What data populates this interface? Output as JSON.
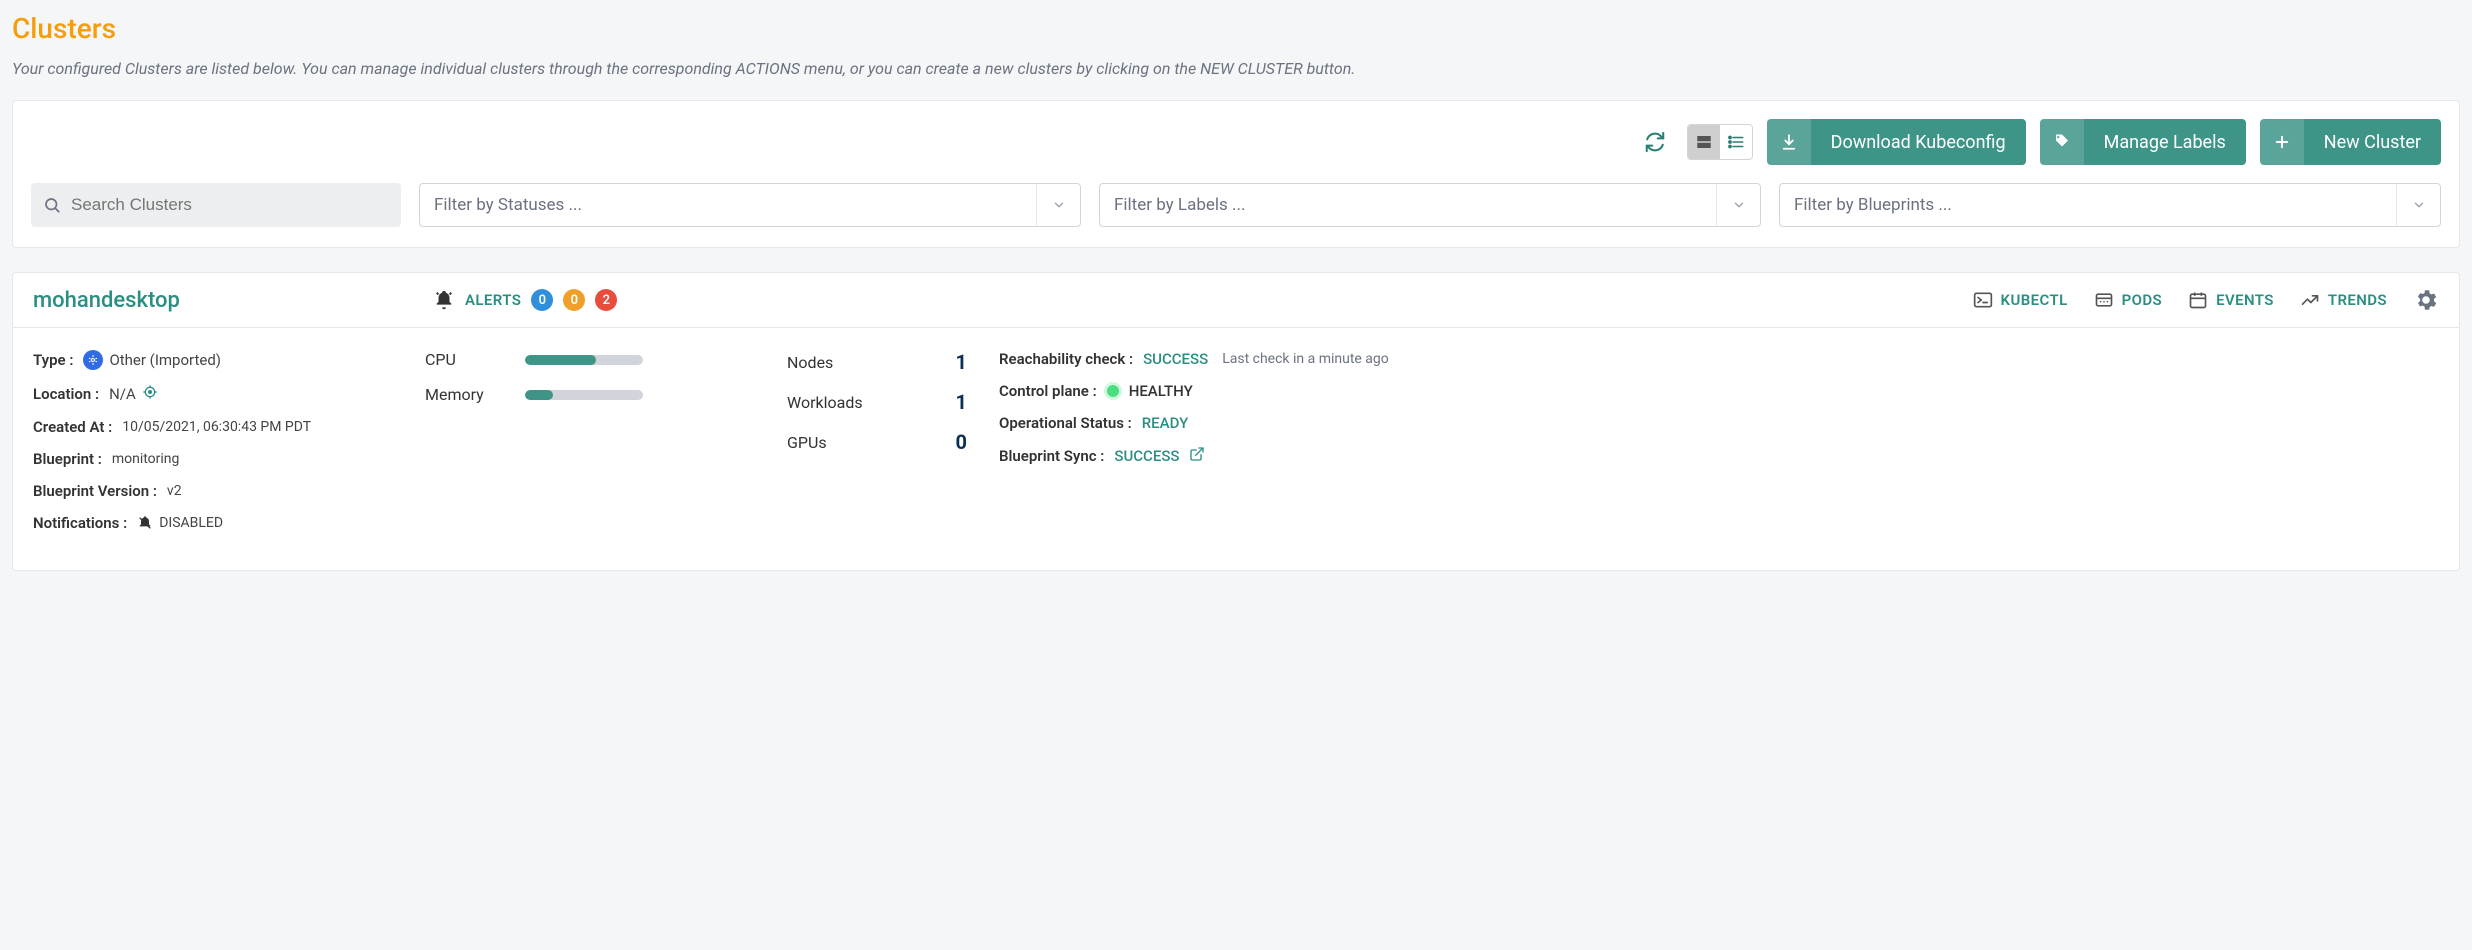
{
  "page": {
    "title": "Clusters",
    "subtitle": "Your configured Clusters are listed below. You can manage individual clusters through the corresponding ACTIONS menu, or you can create a new clusters by clicking on the NEW CLUSTER button."
  },
  "toolbar": {
    "download_label": "Download Kubeconfig",
    "manage_labels_label": "Manage Labels",
    "new_cluster_label": "New Cluster"
  },
  "filters": {
    "search_placeholder": "Search Clusters",
    "status_placeholder": "Filter by Statuses ...",
    "labels_placeholder": "Filter by Labels ...",
    "blueprints_placeholder": "Filter by Blueprints ..."
  },
  "cluster": {
    "name": "mohandesktop",
    "alerts_label": "ALERTS",
    "alert_counts": {
      "info": "0",
      "warn": "0",
      "error": "2"
    },
    "links": {
      "kubectl": "KUBECTL",
      "pods": "PODS",
      "events": "EVENTS",
      "trends": "TRENDS"
    },
    "meta": {
      "type_label": "Type :",
      "type_value": "Other (Imported)",
      "location_label": "Location :",
      "location_value": "N/A",
      "created_label": "Created At :",
      "created_value": "10/05/2021, 06:30:43 PM PDT",
      "blueprint_label": "Blueprint :",
      "blueprint_value": "monitoring",
      "bp_version_label": "Blueprint Version :",
      "bp_version_value": "v2",
      "notifications_label": "Notifications :",
      "notifications_value": "DISABLED"
    },
    "resources": {
      "cpu_label": "CPU",
      "cpu_pct": 60,
      "mem_label": "Memory",
      "mem_pct": 24
    },
    "counts": {
      "nodes_label": "Nodes",
      "nodes_value": "1",
      "workloads_label": "Workloads",
      "workloads_value": "1",
      "gpus_label": "GPUs",
      "gpus_value": "0"
    },
    "status": {
      "reach_label": "Reachability check :",
      "reach_value": "SUCCESS",
      "reach_note": "Last check in a minute ago",
      "cp_label": "Control plane :",
      "cp_value": "HEALTHY",
      "op_label": "Operational Status :",
      "op_value": "READY",
      "bp_sync_label": "Blueprint Sync :",
      "bp_sync_value": "SUCCESS"
    }
  }
}
